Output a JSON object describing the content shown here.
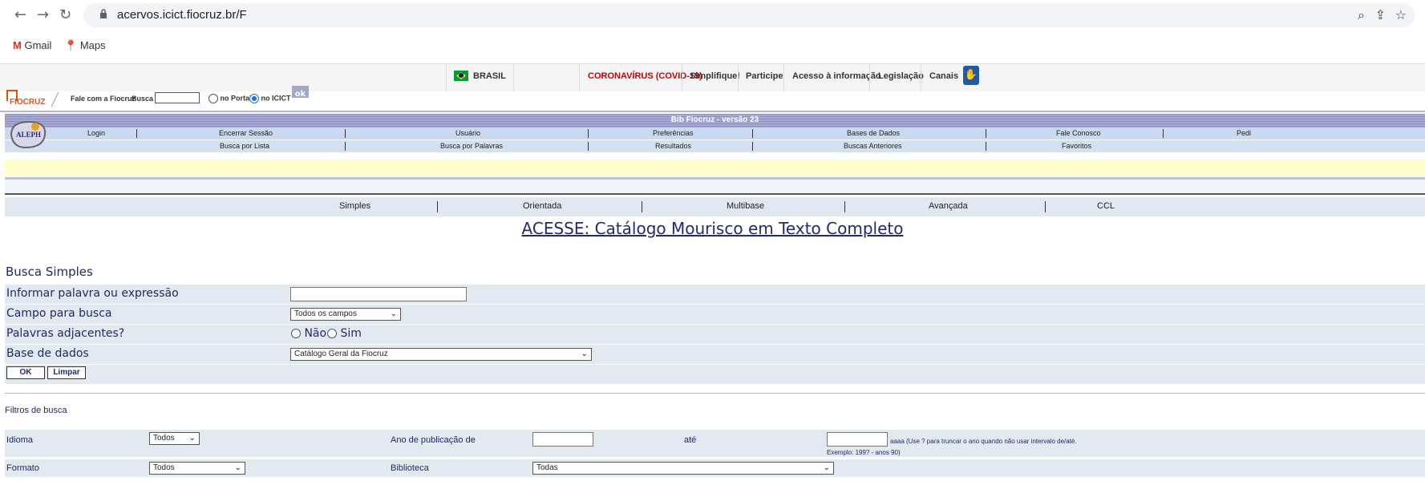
{
  "browser": {
    "url": "acervos.icict.fiocruz.br/F",
    "bookmarks": [
      "Gmail",
      "Maps"
    ]
  },
  "govbar": {
    "country": "BRASIL",
    "covid": "CORONAVÍRUS (COVID-19)",
    "links": [
      "Simplifique!",
      "Participe",
      "Acesso à informação",
      "Legislação",
      "Canais"
    ]
  },
  "fiobar": {
    "brand": "FIOCRUZ",
    "contact": "Fale com a Fiocruz",
    "search_label": "Busca",
    "radio_portal": "no Portal",
    "radio_icict": "no ICICT",
    "ok": "ok"
  },
  "aleph": {
    "title": "Bib Fiocruz - versão 23",
    "logo_text": "ALEPH",
    "menu1": [
      "Login",
      "Encerrar Sessão",
      "Usuário",
      "Preferências",
      "Bases de Dados",
      "Fale Conosco",
      "Pedi"
    ],
    "menu2": [
      "Busca por Lista",
      "Busca por Palavras",
      "Resultados",
      "Buscas Anteriores",
      "Favoritos"
    ],
    "tabs": [
      "Simples",
      "Orientada",
      "Multibase",
      "Avançada",
      "CCL"
    ],
    "acesse": "ACESSE: Catálogo Mourisco em Texto Completo"
  },
  "form": {
    "title": "Busca Simples",
    "word_label": "Informar palavra ou expressão",
    "word_value": "",
    "field_label": "Campo para busca",
    "field_value": "Todos os campos",
    "adj_label": "Palavras adjacentes?",
    "adj_no": "Não",
    "adj_yes": "Sim",
    "db_label": "Base de dados",
    "db_value": "Catálogo Geral da Fiocruz",
    "ok": "OK",
    "clear": "Limpar"
  },
  "filters": {
    "title": "Filtros de busca",
    "lang_label": "Idioma",
    "lang_value": "Todos",
    "year_label": "Ano de publicação de",
    "until_label": "até",
    "year_hint": "aaaa (Use ? para truncar o ano quando não usar intervalo de/até.",
    "year_example": "Exemplo: 199? - anos 90)",
    "format_label": "Formato",
    "format_value": "Todos",
    "library_label": "Biblioteca",
    "library_value": "Todas"
  }
}
